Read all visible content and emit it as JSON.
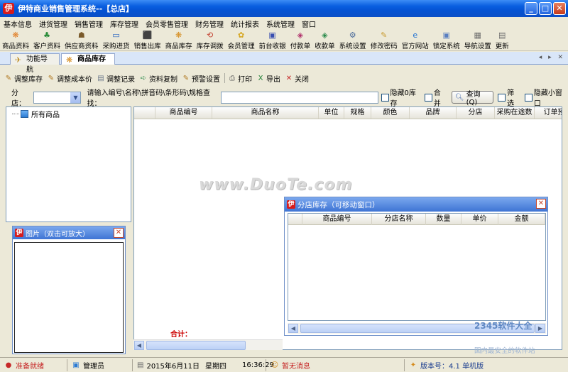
{
  "window": {
    "title": "伊特商业销售管理系统--【总店】",
    "logo_char": "伊",
    "minimize": "_",
    "maximize": "□",
    "close": "✕"
  },
  "menu": [
    "基本信息",
    "进货管理",
    "销售管理",
    "库存管理",
    "会员零售管理",
    "财务管理",
    "统计报表",
    "系统管理",
    "窗口"
  ],
  "toolbar": [
    {
      "label": "商品资料",
      "icon": "goods-icon",
      "glyph": "❋",
      "color": "#e07a1f"
    },
    {
      "label": "客户资料",
      "icon": "customer-icon",
      "glyph": "♣",
      "color": "#2b8c3a"
    },
    {
      "label": "供应商资料",
      "icon": "supplier-icon",
      "glyph": "☗",
      "color": "#7a5a2a"
    },
    {
      "label": "采购进货",
      "icon": "purchase-icon",
      "glyph": "▭",
      "color": "#1f5fbf"
    },
    {
      "label": "销售出库",
      "icon": "sales-icon",
      "glyph": "⬛",
      "color": "#c72b2b"
    },
    {
      "label": "商品库存",
      "icon": "inventory-icon",
      "glyph": "❋",
      "color": "#d58b1c"
    },
    {
      "label": "库存调拨",
      "icon": "transfer-icon",
      "glyph": "⟲",
      "color": "#c23a2a"
    },
    {
      "label": "会员管理",
      "icon": "member-icon",
      "glyph": "✿",
      "color": "#d5a51c"
    },
    {
      "label": "前台收银",
      "icon": "cashier-icon",
      "glyph": "▣",
      "color": "#3a4fb0"
    },
    {
      "label": "付款单",
      "icon": "payment-icon",
      "glyph": "◈",
      "color": "#b0306a"
    },
    {
      "label": "收款单",
      "icon": "receipt-icon",
      "glyph": "◈",
      "color": "#2a8a4a"
    },
    {
      "label": "系统设置",
      "icon": "settings-icon",
      "glyph": "⚙",
      "color": "#4a6a9a"
    },
    {
      "label": "修改密码",
      "icon": "password-icon",
      "glyph": "✎",
      "color": "#c99a30"
    },
    {
      "label": "官方网站",
      "icon": "website-icon",
      "glyph": "e",
      "color": "#1d6fd1"
    },
    {
      "label": "锁定系统",
      "icon": "lock-icon",
      "glyph": "▣",
      "color": "#5a7fc0"
    },
    {
      "label": "导航设置",
      "icon": "nav-settings-icon",
      "glyph": "▦",
      "color": "#6b6b6b"
    },
    {
      "label": "更新",
      "icon": "update-icon",
      "glyph": "▤",
      "color": "#6b6b6b"
    }
  ],
  "tabs": [
    {
      "label": "功能导航",
      "icon": "nav-icon",
      "glyph": "✈"
    },
    {
      "label": "商品库存",
      "icon": "inventory-tab-icon",
      "glyph": "❋"
    }
  ],
  "tab_nav": "◂ ▸ ✕",
  "subtoolbar": [
    {
      "label": "调整库存",
      "icon": "adjust-stock-icon",
      "glyph": "✎",
      "color": "#b07820"
    },
    {
      "label": "调整成本价",
      "icon": "adjust-cost-icon",
      "glyph": "✎",
      "color": "#b07820"
    },
    {
      "label": "调整记录",
      "icon": "adjust-record-icon",
      "glyph": "▤",
      "color": "#6c7a8c"
    },
    {
      "label": "资料复制",
      "icon": "copy-icon",
      "glyph": "➪",
      "color": "#2a8a4a"
    },
    {
      "label": "预警设置",
      "icon": "warning-icon",
      "glyph": "✎",
      "color": "#b07820"
    },
    {
      "label": "打印",
      "icon": "print-icon",
      "glyph": "⎙",
      "color": "#555"
    },
    {
      "label": "导出",
      "icon": "export-icon",
      "glyph": "X",
      "color": "#1e7e34"
    },
    {
      "label": "关闭",
      "icon": "close-icon",
      "glyph": "✕",
      "color": "#c62828"
    }
  ],
  "filter": {
    "store_label": "分店：",
    "store_value": "",
    "search_label": "请输入编号\\名称\\拼音码\\条形码\\规格查找：",
    "search_value": "",
    "hide_zero": "隐藏0库存",
    "merge": "合并",
    "query": "查询(Q)",
    "filter": "筛选",
    "hide_small": "隐藏小窗口"
  },
  "tree": {
    "root": "所有商品"
  },
  "image_window": {
    "title": "图片（双击可放大）"
  },
  "grid": {
    "columns": [
      "",
      "商品编号",
      "商品名称",
      "单位",
      "规格",
      "颜色",
      "品牌",
      "分店",
      "采购在途数",
      "订单预"
    ],
    "total_label": "合计："
  },
  "watermark": "www.DuoTe.com",
  "store_window": {
    "title": "分店库存（可移动窗口）",
    "columns": [
      "",
      "商品编号",
      "分店名称",
      "数量",
      "单价",
      "金额"
    ]
  },
  "corner": {
    "site": "2345软件大全",
    "slogan": "国内最安全的软件站"
  },
  "status": {
    "ready": "准备就绪",
    "user": "管理员",
    "date": "2015年6月11日",
    "weekday": "星期四",
    "time": "16:36:29",
    "message": "暂无消息",
    "version": "版本号：4.1 单机版"
  }
}
